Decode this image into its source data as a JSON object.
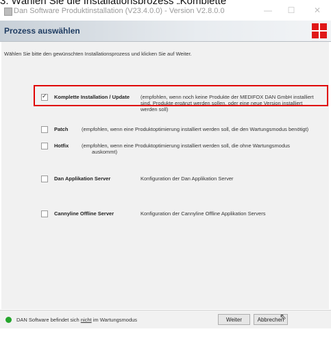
{
  "caption": "3. Wählen Sie die Installationsprozess „Komplette",
  "window": {
    "title": "Dan Software Produktinstallation (V23.4.0.0) - Version V2.8.0.0",
    "minimize": "—",
    "maximize": "☐",
    "close": "✕"
  },
  "header": {
    "title": "Prozess auswählen",
    "logo_color": "#e01818"
  },
  "instruction": "Wählen Sie bitte den gewünschten Installationsprozess und klicken Sie auf Weiter.",
  "options": [
    {
      "name": "Komplette Installation / Update",
      "checked": true,
      "desc_line1": "(empfohlen, wenn noch keine Produkte der MEDIFOX DAN GmbH installiert",
      "desc_line2": "sind, Produkte ergänzt werden sollen, oder eine neue Version installiert",
      "desc_line3": "werden soll)"
    },
    {
      "name": "Patch",
      "checked": false,
      "desc_line1": "(empfohlen, wenn eine Produktoptimierung installiert werden soll, die den Wartungsmodus benötigt)"
    },
    {
      "name": "Hotfix",
      "checked": false,
      "desc_line1": "(empfohlen, wenn eine Produktoptimierung installiert werden soll, die ohne Wartungsmodus",
      "desc_line2": "auskommt)"
    },
    {
      "name": "Dan Applikation Server",
      "checked": false,
      "desc_line1": "Konfiguration der Dan Applikation Server"
    },
    {
      "name": "Cannyline Offline Server",
      "checked": false,
      "desc_line1": "Konfiguration der Cannyline Offline Applikation Servers"
    }
  ],
  "status": {
    "text_before": "DAN Software befindet sich ",
    "text_underlined": "nicht",
    "text_after": " im Wartungsmodus",
    "indicator_color": "#25a52c"
  },
  "buttons": {
    "next": "Weiter",
    "cancel": "Abbrechen"
  },
  "checkmark_glyph": "✓"
}
